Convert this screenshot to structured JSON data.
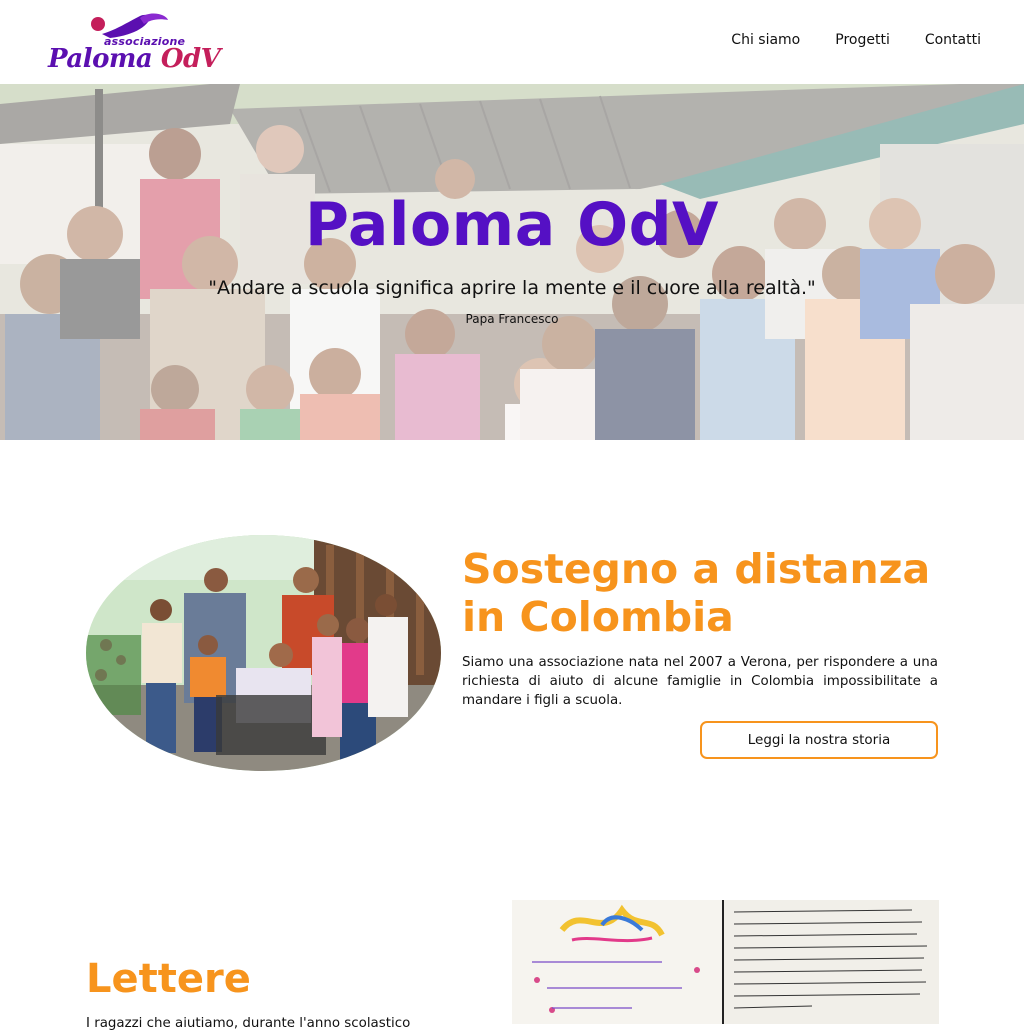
{
  "header": {
    "logo_small": "associazione",
    "logo_word1": "Paloma",
    "logo_word2": "OdV",
    "nav": [
      "Chi siamo",
      "Progetti",
      "Contatti"
    ]
  },
  "hero": {
    "title": "Paloma OdV",
    "quote": "\"Andare a scuola significa aprire la mente e il cuore alla realtà.\"",
    "author": "Papa Francesco"
  },
  "sostegno": {
    "title": "Sostegno a distanza in Colombia",
    "description": "Siamo una associazione nata nel 2007 a Verona, per rispondere a una richiesta di aiuto di alcune famiglie in Colombia impossibilitate a mandare i figli a scuola.",
    "button": "Leggi la nostra storia"
  },
  "lettere": {
    "title": "Lettere",
    "intro": "I ragazzi che aiutiamo, durante l'anno scolastico"
  },
  "colors": {
    "purple": "#5510c4",
    "orange": "#f7941d",
    "logo_red": "#c41f5b"
  },
  "icons": {
    "logo": "dove-logo-icon"
  }
}
